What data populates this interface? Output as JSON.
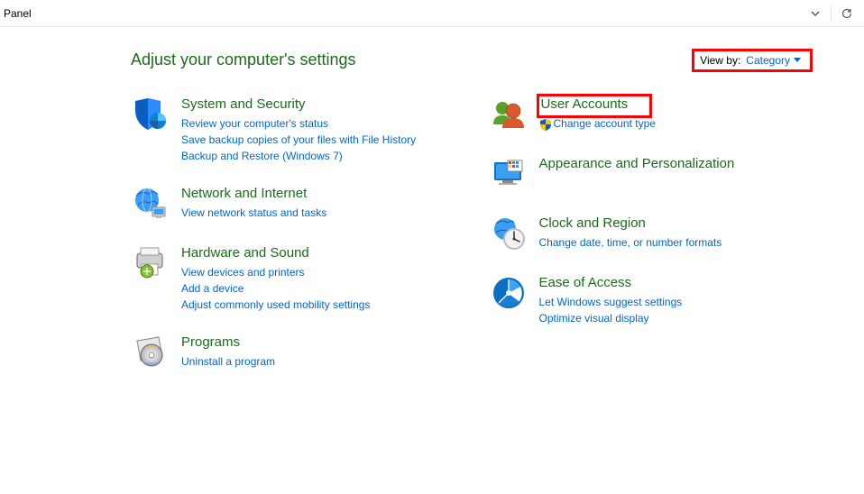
{
  "titlebar": {
    "title": "Panel"
  },
  "header": {
    "heading": "Adjust your computer's settings",
    "viewby_label": "View by:",
    "viewby_value": "Category"
  },
  "left": {
    "system": {
      "title": "System and Security",
      "links": [
        "Review your computer's status",
        "Save backup copies of your files with File History",
        "Backup and Restore (Windows 7)"
      ]
    },
    "network": {
      "title": "Network and Internet",
      "links": [
        "View network status and tasks"
      ]
    },
    "hardware": {
      "title": "Hardware and Sound",
      "links": [
        "View devices and printers",
        "Add a device",
        "Adjust commonly used mobility settings"
      ]
    },
    "programs": {
      "title": "Programs",
      "links": [
        "Uninstall a program"
      ]
    }
  },
  "right": {
    "users": {
      "title": "User Accounts",
      "links": [
        "Change account type"
      ]
    },
    "appearance": {
      "title": "Appearance and Personalization"
    },
    "clock": {
      "title": "Clock and Region",
      "links": [
        "Change date, time, or number formats"
      ]
    },
    "ease": {
      "title": "Ease of Access",
      "links": [
        "Let Windows suggest settings",
        "Optimize visual display"
      ]
    }
  }
}
